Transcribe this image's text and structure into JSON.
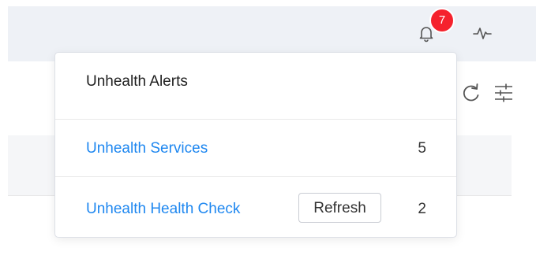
{
  "header": {
    "notifications": {
      "icon": "bell-icon",
      "badge_count": "7",
      "badge_color": "#f5222d"
    },
    "activity_icon": "activity-pulse-icon"
  },
  "toolbar": {
    "refresh_icon": "refresh-icon",
    "filter_icon": "sliders-icon"
  },
  "alerts_popover": {
    "title": "Unhealth Alerts",
    "items": [
      {
        "label": "Unhealth Services",
        "count": "5"
      },
      {
        "label": "Unhealth Health Check",
        "count": "2",
        "action_label": "Refresh"
      }
    ]
  },
  "colors": {
    "link": "#1e87f0",
    "header_bg": "#eef1f6",
    "badge": "#f5222d"
  }
}
